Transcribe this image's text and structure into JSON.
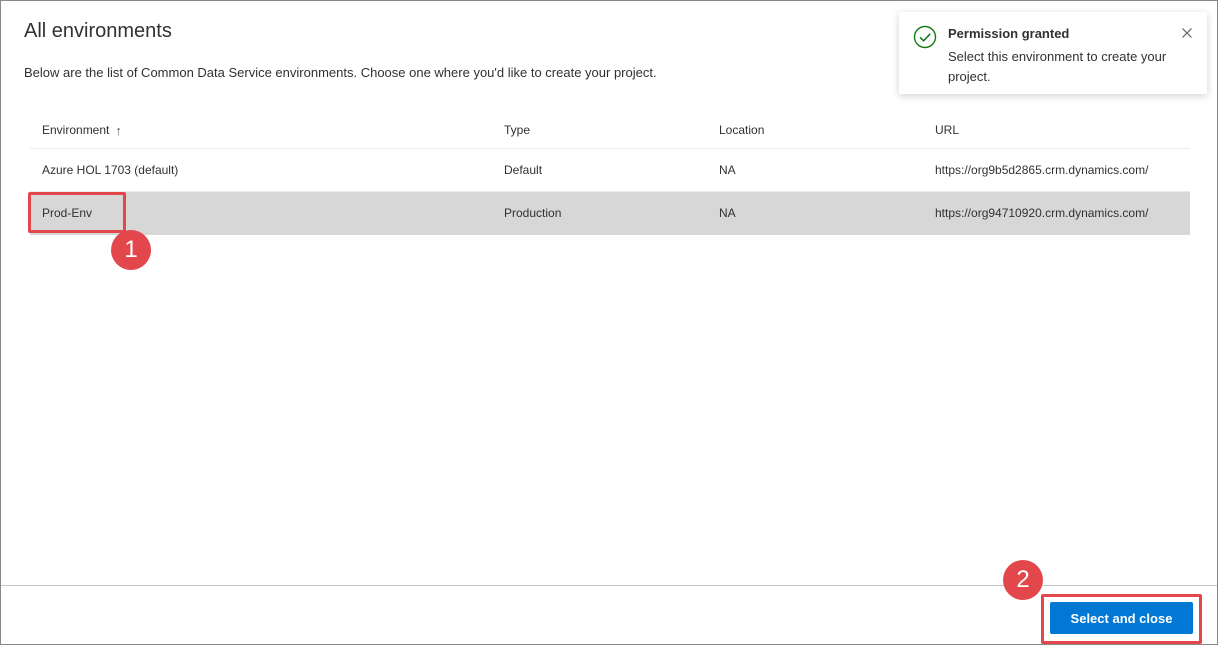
{
  "page": {
    "title": "All environments",
    "subtitle": "Below are the list of Common Data Service environments. Choose one where you'd like to create your project."
  },
  "table": {
    "columns": [
      "Environment",
      "Type",
      "Location",
      "URL"
    ],
    "sort_icon": "arrow-up-icon",
    "rows": [
      {
        "environment": "Azure HOL 1703 (default)",
        "type": "Default",
        "location": "NA",
        "url": "https://org9b5d2865.crm.dynamics.com/",
        "selected": false
      },
      {
        "environment": "Prod-Env",
        "type": "Production",
        "location": "NA",
        "url": "https://org94710920.crm.dynamics.com/",
        "selected": true
      }
    ]
  },
  "toast": {
    "title": "Permission granted",
    "message": "Select this environment to create your project.",
    "icon": "check-circle-icon",
    "success_color": "#107c10"
  },
  "footer": {
    "select_button_label": "Select and close"
  },
  "annotations": {
    "badge1": "1",
    "badge2": "2",
    "color": "#e3474b"
  },
  "colors": {
    "accent": "#0078d4",
    "selected_row": "#d7d7d7"
  }
}
